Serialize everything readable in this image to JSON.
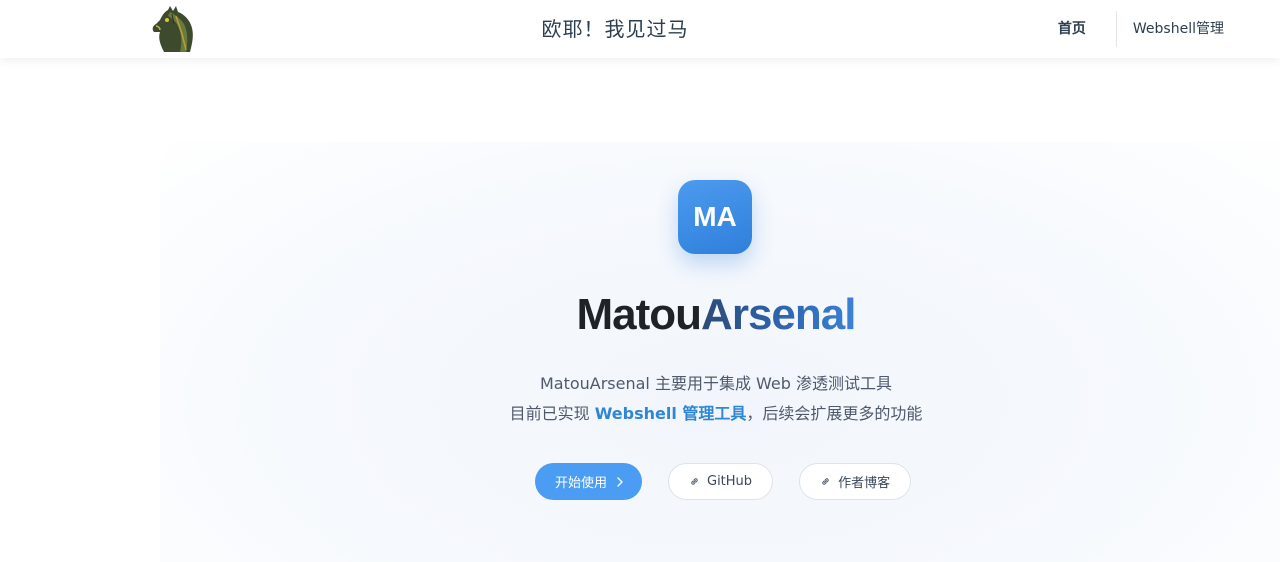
{
  "header": {
    "site_title": "欧耶！我见过马",
    "nav": [
      {
        "label": "首页",
        "active": true
      },
      {
        "label": "Webshell管理",
        "active": false
      }
    ]
  },
  "hero": {
    "badge_text": "MA",
    "title_part1": "Matou",
    "title_part2": "Arsenal",
    "desc_line1": "MatouArsenal 主要用于集成 Web 渗透测试工具",
    "desc_line2_prefix": "目前已实现 ",
    "desc_line2_highlight": "Webshell 管理工具",
    "desc_line2_suffix": "，后续会扩展更多的功能",
    "actions": [
      {
        "label": "开始使用",
        "icon": "chevron-right-icon"
      },
      {
        "label": "GitHub",
        "icon": "link-icon"
      },
      {
        "label": "作者博客",
        "icon": "link-icon"
      }
    ]
  },
  "colors": {
    "accent": "#4a9df3",
    "highlight": "#2f86d4",
    "badge": "#3a8be6"
  }
}
